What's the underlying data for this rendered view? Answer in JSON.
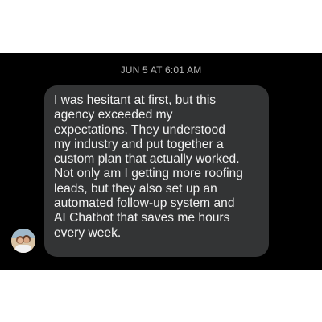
{
  "conversation": {
    "timestamp": "JUN 5 AT 6:01 AM",
    "message": {
      "sender_avatar_icon": "avatar-photo",
      "text": "I was hesitant at first, but this\nagency exceeded my\nexpectations. They understood\nmy industry and put together a\ncustom plan that actually worked.\nNot only am I getting more roofing\nleads, but they also set up an\nautomated follow-up system and\nAI Chatbot that saves me hours\nevery week."
    }
  },
  "colors": {
    "background": "#000000",
    "bubble": "#333435",
    "text": "#f2f2f2",
    "timestamp": "#b7b7b7"
  }
}
